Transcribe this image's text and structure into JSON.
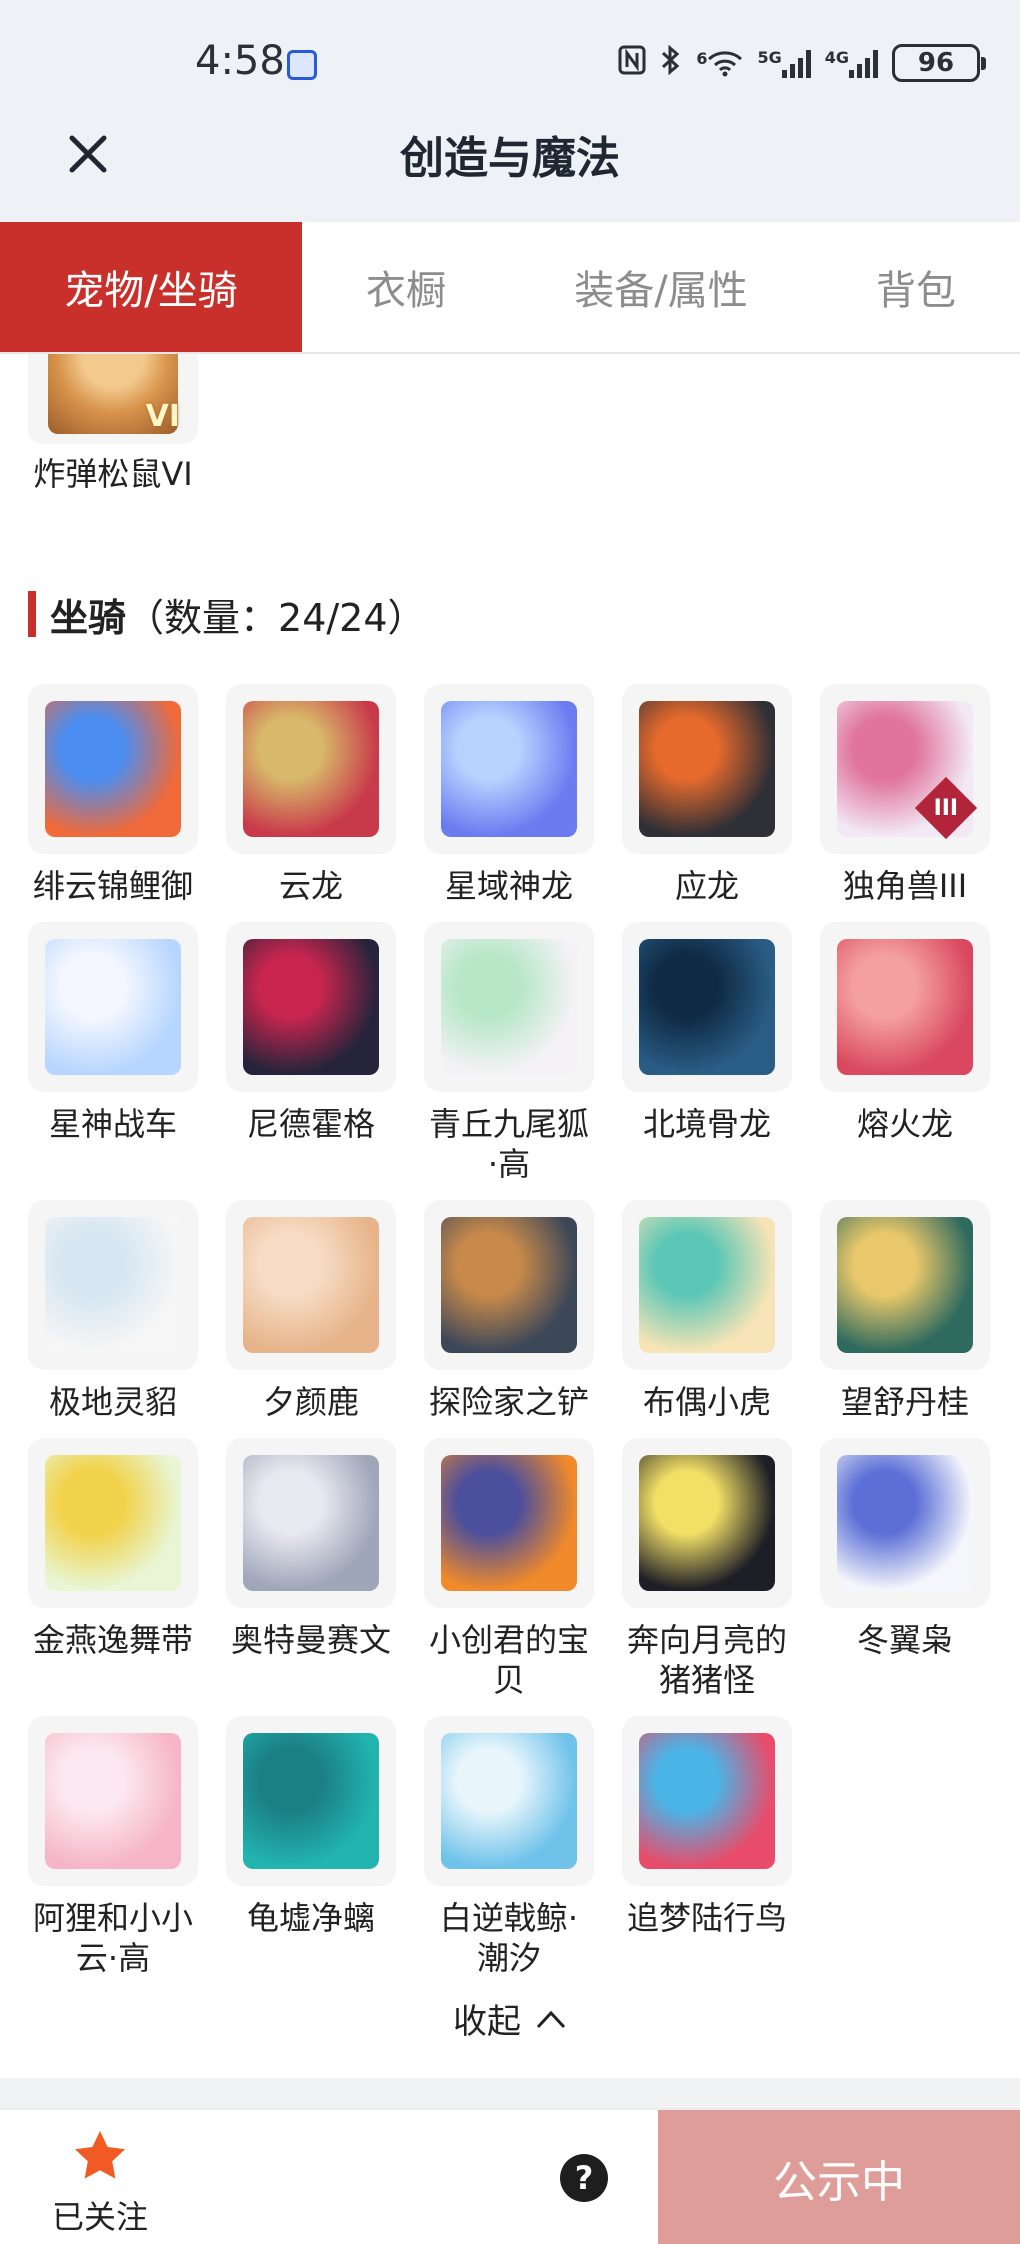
{
  "status_bar": {
    "time": "4:58",
    "battery": "96",
    "net1": "6",
    "net2": "5G",
    "net3": "4G"
  },
  "header": {
    "title": "创造与魔法"
  },
  "tabs": [
    {
      "label": "宠物/坐骑",
      "active": true
    },
    {
      "label": "衣橱",
      "active": false
    },
    {
      "label": "装备/属性",
      "active": false
    },
    {
      "label": "背包",
      "active": false
    }
  ],
  "pets_partial": {
    "name": "炸弹松鼠VI",
    "badge": "VI"
  },
  "mounts": {
    "section_title": "坐骑",
    "count_text": "（数量：24/24）",
    "items": [
      {
        "name": "绯云锦鲤御",
        "color_a": "#f06a3a",
        "color_b": "#4b8df0"
      },
      {
        "name": "云龙",
        "color_a": "#c83a4a",
        "color_b": "#d8b86a"
      },
      {
        "name": "星域神龙",
        "color_a": "#6a7cf0",
        "color_b": "#b6d2ff"
      },
      {
        "name": "应龙",
        "color_a": "#2f2f36",
        "color_b": "#e56a2c"
      },
      {
        "name": "独角兽III",
        "color_a": "#f2e9f4",
        "color_b": "#e0749c",
        "mark": "III"
      },
      {
        "name": "星神战车",
        "color_a": "#b7d6ff",
        "color_b": "#f4f7ff"
      },
      {
        "name": "尼德霍格",
        "color_a": "#26243a",
        "color_b": "#c7254e"
      },
      {
        "name": "青丘九尾狐·高",
        "color_a": "#f4f2f6",
        "color_b": "#b7e7c7"
      },
      {
        "name": "北境骨龙",
        "color_a": "#2a5d86",
        "color_b": "#0f2a44"
      },
      {
        "name": "熔火龙",
        "color_a": "#d9485e",
        "color_b": "#f4a0a0"
      },
      {
        "name": "极地灵貂",
        "color_a": "#f6f6f6",
        "color_b": "#d6e6f2"
      },
      {
        "name": "夕颜鹿",
        "color_a": "#e7b48a",
        "color_b": "#f6dcc4"
      },
      {
        "name": "探险家之铲",
        "color_a": "#3c4758",
        "color_b": "#c88a4a"
      },
      {
        "name": "布偶小虎",
        "color_a": "#f6e4b6",
        "color_b": "#5cc7b6"
      },
      {
        "name": "望舒丹桂",
        "color_a": "#2f6a5e",
        "color_b": "#e8c86a"
      },
      {
        "name": "金燕逸舞带",
        "color_a": "#e8f6d6",
        "color_b": "#f2d24a"
      },
      {
        "name": "奥特曼赛文",
        "color_a": "#9fa6b8",
        "color_b": "#e8e8f0"
      },
      {
        "name": "小创君的宝贝",
        "color_a": "#f08a2a",
        "color_b": "#4c4f9c"
      },
      {
        "name": "奔向月亮的猪猪怪",
        "color_a": "#1e1e26",
        "color_b": "#f2e066"
      },
      {
        "name": "冬翼枭",
        "color_a": "#f4f6fb",
        "color_b": "#5b6fd6"
      },
      {
        "name": "阿狸和小小云·高",
        "color_a": "#f6b5c6",
        "color_b": "#fce8f0"
      },
      {
        "name": "龟墟净螭",
        "color_a": "#22b5b0",
        "color_b": "#1b7f86"
      },
      {
        "name": "白逆戟鲸·潮汐",
        "color_a": "#6fc2ea",
        "color_b": "#e8f6fc"
      },
      {
        "name": "追梦陆行鸟",
        "color_a": "#e84c6a",
        "color_b": "#4bb4e6"
      }
    ]
  },
  "collapse": {
    "label": "收起"
  },
  "bottom_bar": {
    "follow_label": "已关注",
    "help": "?",
    "publish_label": "公示中"
  },
  "colors": {
    "accent": "#c9302c",
    "publish_bg": "#df9d9a",
    "star": "#f15a22"
  }
}
